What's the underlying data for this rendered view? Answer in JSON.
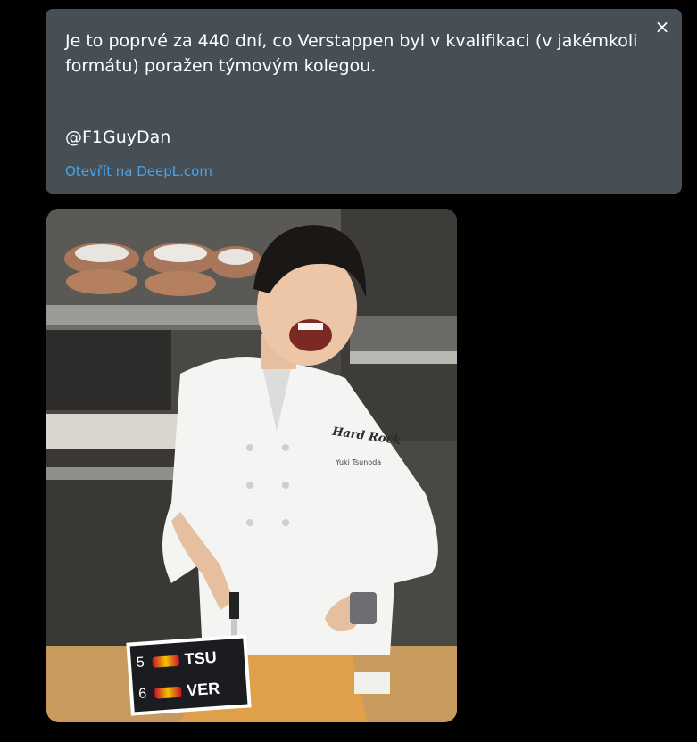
{
  "translation": {
    "text": "Je to poprvé za 440 dní, co Verstappen byl v kvalifikaci (v jakémkoli formátu) poražen týmovým kolegou.",
    "author": "@F1GuyDan",
    "link_label": "Otevřít na DeepL.com",
    "close_label": "×"
  },
  "media": {
    "overlay": {
      "rows": [
        {
          "position": "5",
          "driver": "TSU"
        },
        {
          "position": "6",
          "driver": "VER"
        }
      ]
    },
    "jacket_brand": "Hard Rock",
    "jacket_name": "Yuki Tsunoda"
  },
  "colors": {
    "card_bg": "#464e56",
    "link": "#4aa3e6",
    "page_bg": "#000000"
  }
}
